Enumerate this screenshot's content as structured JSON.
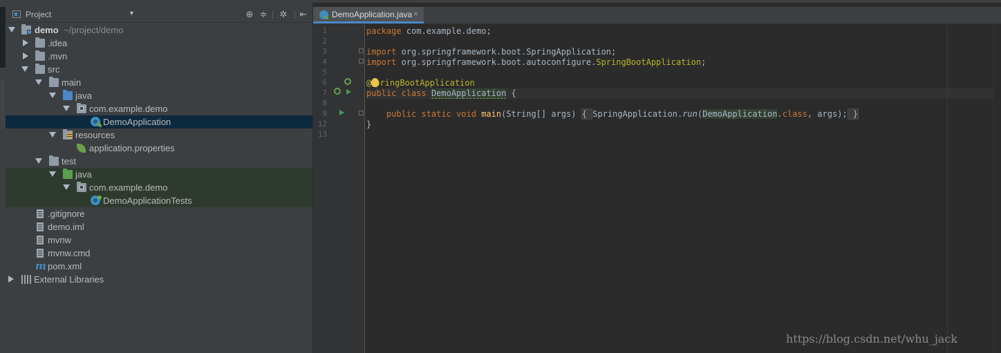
{
  "project_panel": {
    "title": "Project",
    "tree": [
      {
        "label": "demo",
        "path": "~/project/demo"
      },
      {
        "label": ".idea"
      },
      {
        "label": ".mvn"
      },
      {
        "label": "src"
      },
      {
        "label": "main"
      },
      {
        "label": "java"
      },
      {
        "label": "com.example.demo"
      },
      {
        "label": "DemoApplication"
      },
      {
        "label": "resources"
      },
      {
        "label": "application.properties"
      },
      {
        "label": "test"
      },
      {
        "label": "java"
      },
      {
        "label": "com.example.demo"
      },
      {
        "label": "DemoApplicationTests"
      },
      {
        "label": ".gitignore"
      },
      {
        "label": "demo.iml"
      },
      {
        "label": "mvnw"
      },
      {
        "label": "mvnw.cmd"
      },
      {
        "label": "pom.xml"
      },
      {
        "label": "External Libraries"
      }
    ]
  },
  "editor": {
    "tab_label": "DemoApplication.java",
    "tab_close": "×",
    "line_numbers": [
      "1",
      "2",
      "3",
      "4",
      "5",
      "6",
      "7",
      "8",
      "9",
      "12",
      "13"
    ],
    "code": {
      "l1_kw": "package",
      "l1_rest": " com.example.demo;",
      "l3_kw": "import",
      "l3_rest": " org.springframework.boot.SpringApplication;",
      "l4_kw": "import",
      "l4_pre": " org.springframework.boot.autoconfigure.",
      "l4_ann": "SpringBootApplication",
      "l4_end": ";",
      "l6_at": "@",
      "l6_ann": "pringBootApplication",
      "l7_kw": "public class",
      "l7_sp": " ",
      "l7_cls": "DemoApplication",
      "l7_end": " {",
      "l9_indent": "    ",
      "l9_kw": "public static void",
      "l9_sp": " ",
      "l9_mth": "main",
      "l9_args": "(String[] args) ",
      "l9_fold_open": "{ ",
      "l9_call": "SpringApplication.",
      "l9_run": "run",
      "l9_paren": "(",
      "l9_cls": "DemoApplication",
      "l9_dot": ".",
      "l9_kw2": "class",
      "l9_tail": ", args);",
      "l9_fold_close": " }",
      "l12": "}"
    }
  },
  "watermark": "https://blog.csdn.net/whu_jack",
  "colors": {
    "keyword": "#cc7832",
    "annotation": "#bbb529",
    "method": "#ffc66d",
    "selection": "#0d293e",
    "test_bg": "#2f3a2f",
    "folder_blue": "#4a88c7",
    "folder_green": "#5a9e4b"
  }
}
